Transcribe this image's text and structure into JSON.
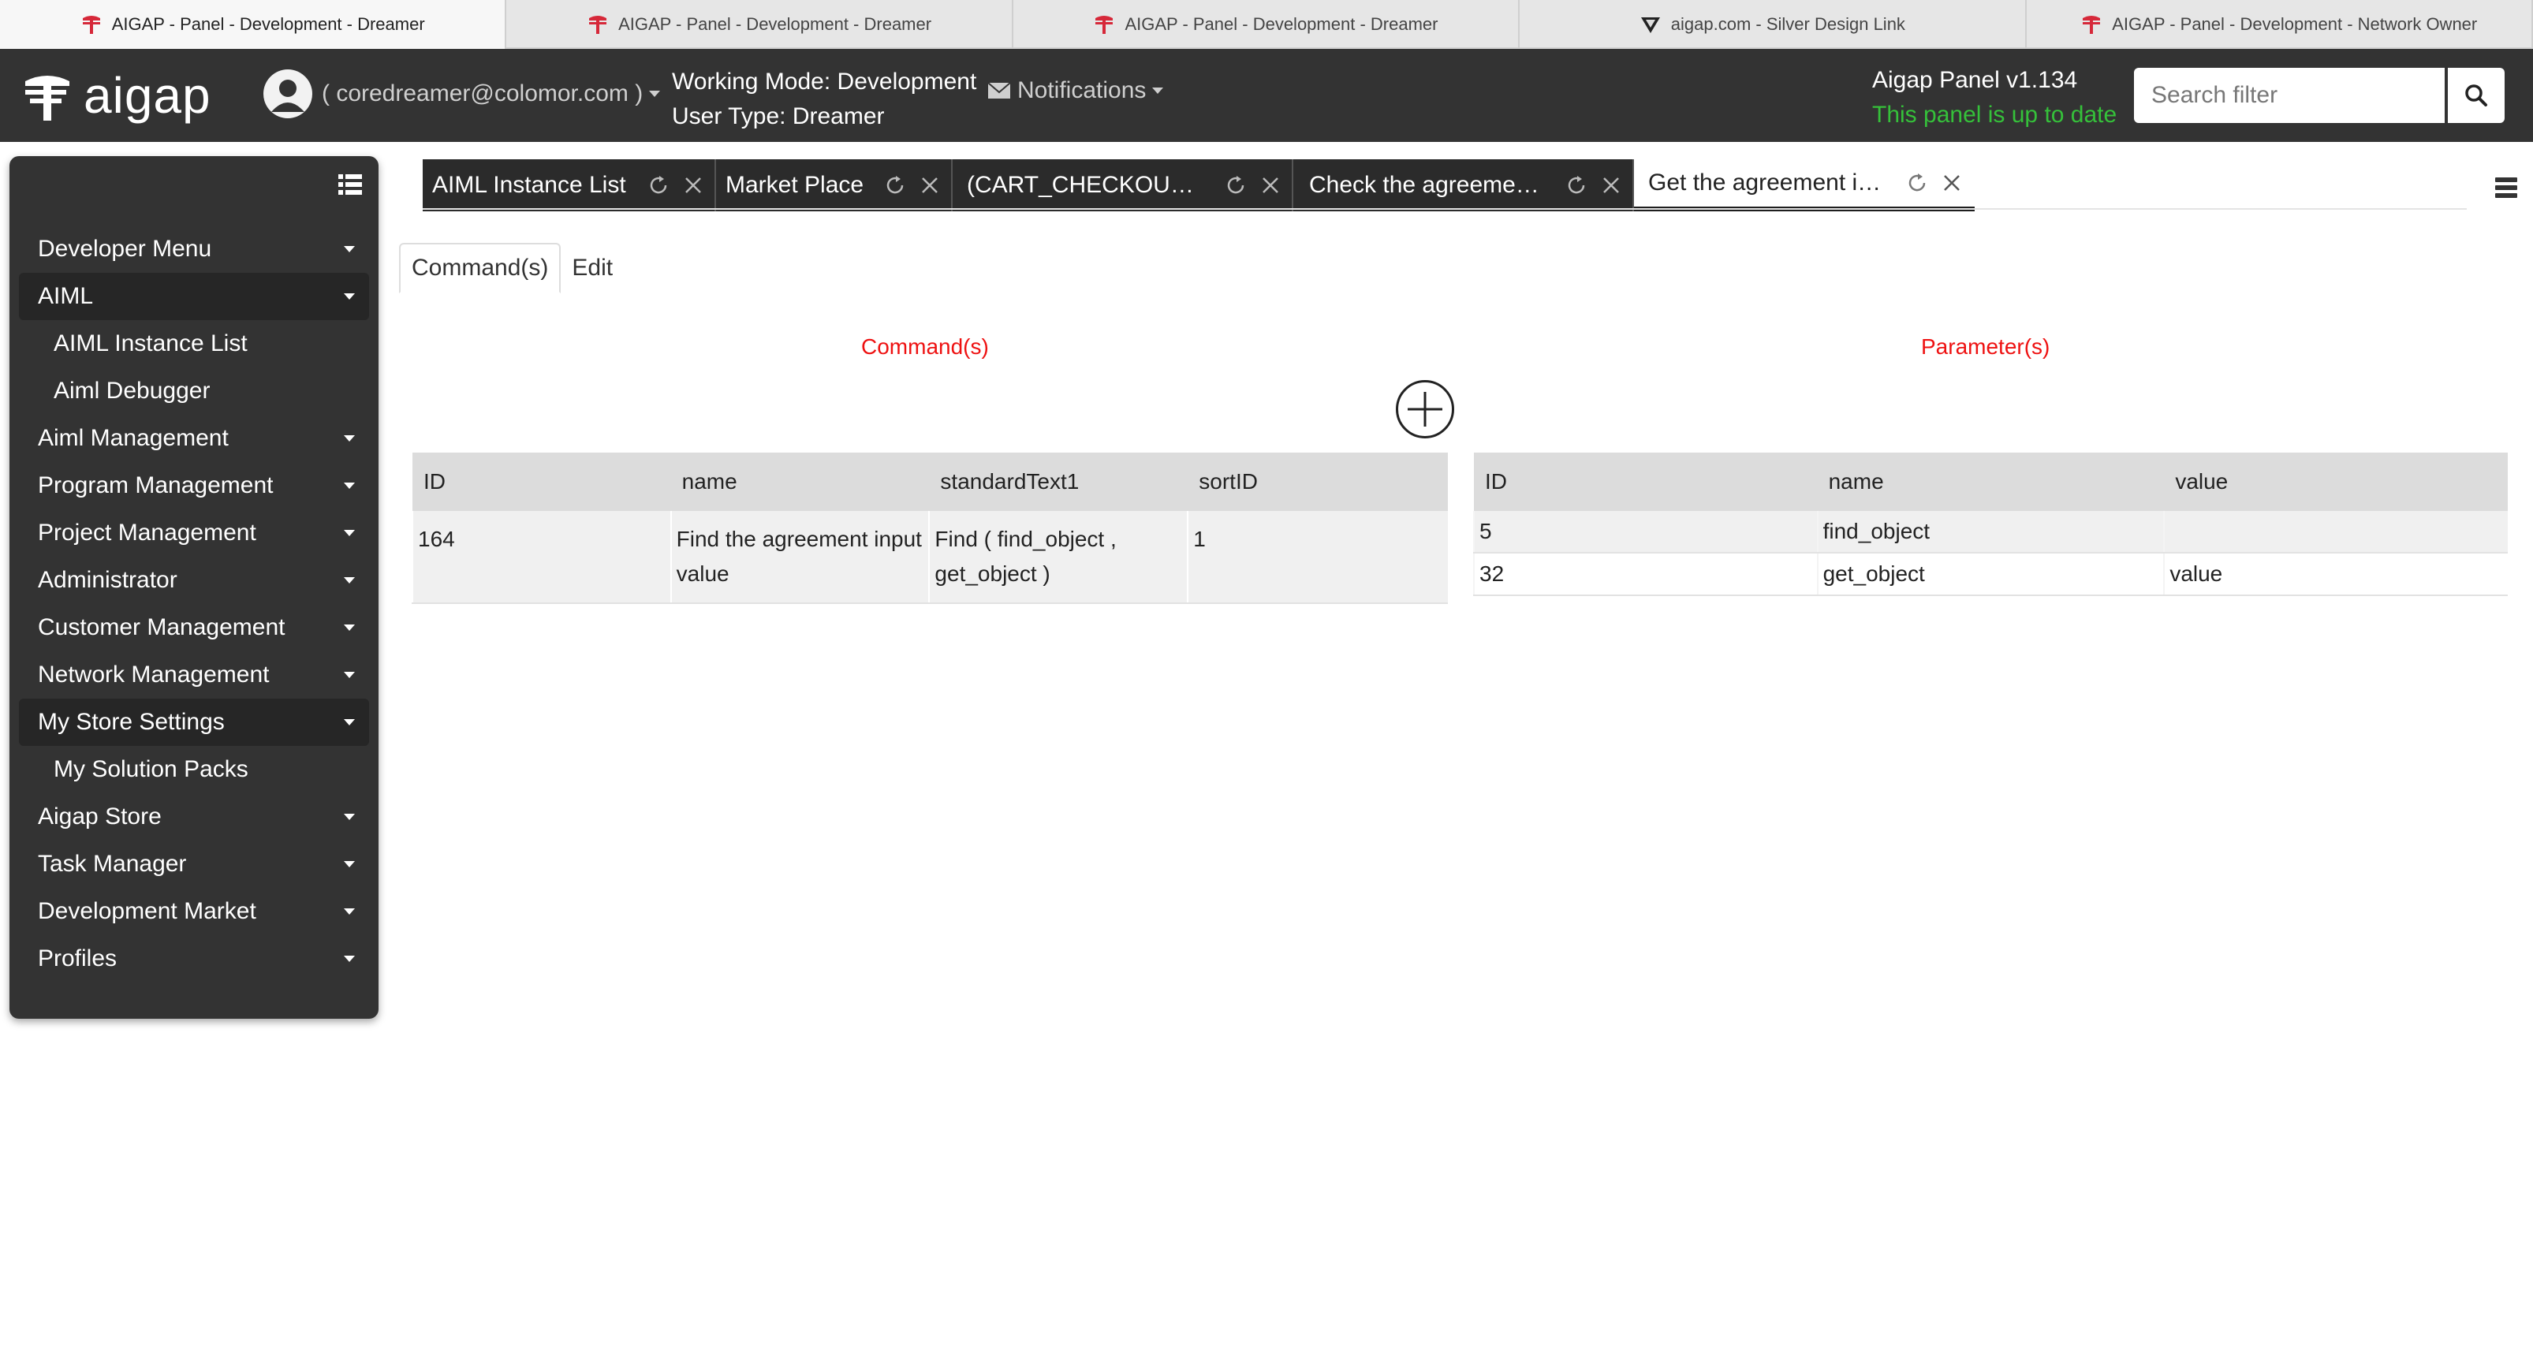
{
  "browser_tabs": [
    {
      "title": "AIGAP - Panel - Development - Dreamer",
      "icon": "aigap-icon"
    },
    {
      "title": "AIGAP - Panel - Development - Dreamer",
      "icon": "aigap-icon"
    },
    {
      "title": "AIGAP - Panel - Development - Dreamer",
      "icon": "aigap-icon"
    },
    {
      "title": "aigap.com - Silver Design Link",
      "icon": "silver-design-icon"
    },
    {
      "title": "AIGAP - Panel - Development - Network Owner",
      "icon": "aigap-icon"
    }
  ],
  "header": {
    "logo_text": "aigap",
    "user_email": "( coredreamer@colomor.com )",
    "working_mode": "Working Mode: Development",
    "user_type": "User Type: Dreamer",
    "notifications_label": "Notifications",
    "version": "Aigap Panel v1.134",
    "status": "This panel is up to date",
    "search_placeholder": "Search filter"
  },
  "sidebar": {
    "items": [
      {
        "label": "Developer Menu",
        "caret": true
      },
      {
        "label": "AIML",
        "caret": true,
        "open": true
      },
      {
        "label": "AIML Instance List",
        "sub": true
      },
      {
        "label": "Aiml Debugger",
        "sub": true
      },
      {
        "label": "Aiml Management",
        "caret": true
      },
      {
        "label": "Program Management",
        "caret": true
      },
      {
        "label": "Project Management",
        "caret": true
      },
      {
        "label": "Administrator",
        "caret": true
      },
      {
        "label": "Customer Management",
        "caret": true
      },
      {
        "label": "Network Management",
        "caret": true
      },
      {
        "label": "My Store Settings",
        "caret": true,
        "open": true
      },
      {
        "label": "My Solution Packs",
        "sub": true
      },
      {
        "label": "Aigap Store",
        "caret": true
      },
      {
        "label": "Task Manager",
        "caret": true
      },
      {
        "label": "Development Market",
        "caret": true
      },
      {
        "label": "Profiles",
        "caret": true
      }
    ]
  },
  "content_tabs": [
    {
      "label": "AIML Instance List"
    },
    {
      "label": "Market Place"
    },
    {
      "label": "(CART_CHECKOU…"
    },
    {
      "label": "Check the agreeme…"
    },
    {
      "label": "Get the agreement i…",
      "active": true
    }
  ],
  "subtabs": [
    "Command(s)",
    "Edit"
  ],
  "commands": {
    "title": "Command(s)",
    "columns": [
      "ID",
      "name",
      "standardText1",
      "sortID"
    ],
    "rows": [
      [
        "164",
        "Find the agreement input value",
        "Find ( find_object , get_object )",
        "1"
      ]
    ]
  },
  "parameters": {
    "title": "Parameter(s)",
    "columns": [
      "ID",
      "name",
      "value"
    ],
    "rows": [
      [
        "5",
        "find_object",
        ""
      ],
      [
        "32",
        "get_object",
        "value"
      ]
    ]
  },
  "colors": {
    "header_bg": "#333333",
    "status_green": "#35c13a",
    "section_title_red": "#ee1111"
  }
}
